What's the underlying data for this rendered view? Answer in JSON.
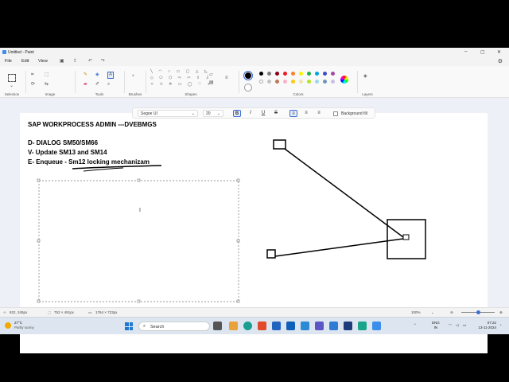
{
  "window": {
    "title": "Untitled - Paint"
  },
  "menu": {
    "file": "File",
    "edit": "Edit",
    "view": "View"
  },
  "ribbon": {
    "selection": "Selection",
    "image": "Image",
    "tools": "Tools",
    "brushes": "Brushes",
    "shapes": "Shapes",
    "colors": "Colors",
    "layers": "Layers"
  },
  "palette": {
    "row1": [
      "#000000",
      "#7f7f7f",
      "#880015",
      "#ed1c24",
      "#ff7f27",
      "#fff200",
      "#22b14c",
      "#00a2e8",
      "#3f48cc",
      "#a349a4"
    ],
    "row2": [
      "#ffffff",
      "#c3c3c3",
      "#b97a57",
      "#ffaec9",
      "#ffc90e",
      "#efe4b0",
      "#b5e61d",
      "#99d9ea",
      "#7092be",
      "#c8bfe7"
    ]
  },
  "textbar": {
    "font": "Segoe UI",
    "size": "20",
    "bold": "B",
    "italic": "I",
    "underline": "U",
    "strike": "S",
    "background_fill": "Background fill"
  },
  "canvas_text": {
    "line1": "SAP WORKPROCESS ADMIN ---DVEBMGS",
    "line2": "D- DIALOG SM50/SM66",
    "line3": "V- Update SM13 and SM14",
    "line4": "E- Enqueue - Sm12 locking mechanizam"
  },
  "status": {
    "cursor_pos": "822, 345px",
    "selection_size": "752 × 491px",
    "canvas_size": "1764 × 723px",
    "zoom": "100%"
  },
  "taskbar": {
    "temp": "27°C",
    "weather": "Partly sunny",
    "search": "Search",
    "lang1": "ENG",
    "lang2": "IN",
    "time": "07:22",
    "date": "13-11-2024"
  }
}
